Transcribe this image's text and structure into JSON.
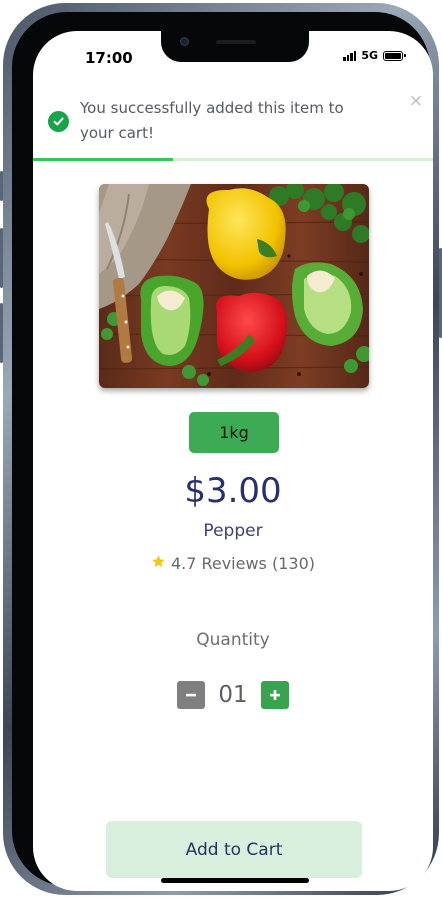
{
  "status_bar": {
    "time": "17:00",
    "network": "5G"
  },
  "toast": {
    "message": "You successfully added this item to your cart!",
    "close_symbol": "×",
    "progress_fraction": 0.35
  },
  "product": {
    "weight": "1kg",
    "price": "$3.00",
    "name": "Pepper",
    "rating": "4.7",
    "reviews_label": "Reviews (130)"
  },
  "quantity": {
    "label": "Quantity",
    "value": "01",
    "minus_symbol": "−",
    "plus_symbol": "+"
  },
  "actions": {
    "add_to_cart_label": "Add to Cart"
  },
  "colors": {
    "accent_green": "#3daa55",
    "price_navy": "#28306b",
    "cart_button_bg": "#d9efdd",
    "toast_progress": "#34c759",
    "star": "#f5c518"
  },
  "icons": {
    "toast_icon": "check-circle-icon",
    "close_icon": "close-icon",
    "rating_icon": "star-icon",
    "minus_icon": "minus-icon",
    "plus_icon": "plus-icon"
  }
}
